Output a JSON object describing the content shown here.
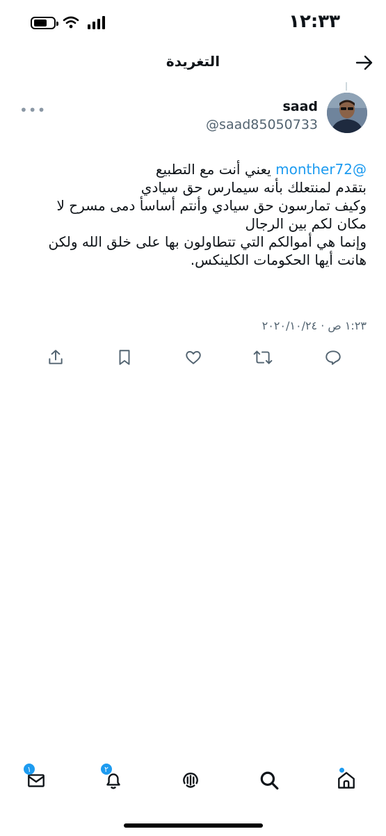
{
  "status_bar": {
    "time": "١٢:٣٣"
  },
  "header": {
    "title": "التغريدة"
  },
  "tweet": {
    "author_name": "saad",
    "author_handle": "@saad85050733",
    "mention": "@monther72",
    "line1_rest": " يعني أنت مع التطبيع",
    "line2": "بتقدم لمنتعلك بأنه سيمارس حق سيادي",
    "line3": "وكيف تمارسون حق سيادي وأنتم أساسأ دمى مسرح لا",
    "line4": "مكان لكم بين الرجال",
    "line5": "وإنما هي أموالكم التي تتطاولون بها على خلق الله ولكن",
    "line6": "هانت أيها الحكومات الكلينكس.",
    "timestamp": "١:٢٣ ص · ٢٠٢٠/١٠/٢٤"
  },
  "actions": [
    "reply-icon",
    "retweet-icon",
    "like-icon",
    "bookmark-icon",
    "share-icon"
  ],
  "tab_bar": {
    "home_icon": "home-icon",
    "search_icon": "search-icon",
    "spaces_icon": "spaces-icon",
    "notifications_badge": "٢",
    "messages_badge": "١"
  },
  "colors": {
    "accent": "#1d9bf0",
    "secondary_text": "#536471"
  }
}
